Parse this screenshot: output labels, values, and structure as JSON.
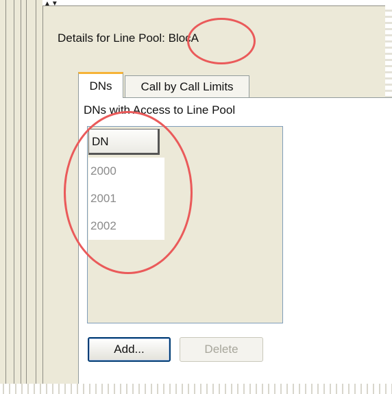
{
  "panel": {
    "scroll_arrows": "▲▼",
    "title": "Details for Line Pool: BlocA"
  },
  "tabs": [
    {
      "label": "DNs",
      "active": true
    },
    {
      "label": "Call by Call Limits",
      "active": false
    }
  ],
  "dns_tab": {
    "group_label": "DNs with Access to Line Pool",
    "table": {
      "column_header": "DN",
      "rows": [
        "2000",
        "2001",
        "2002"
      ]
    },
    "buttons": {
      "add_label": "Add...",
      "delete_label": "Delete"
    }
  },
  "colors": {
    "panel_bg": "#ece9d8",
    "tab_accent": "#f6b337",
    "annotation": "#ea5a5a",
    "button_border": "#003c74"
  }
}
